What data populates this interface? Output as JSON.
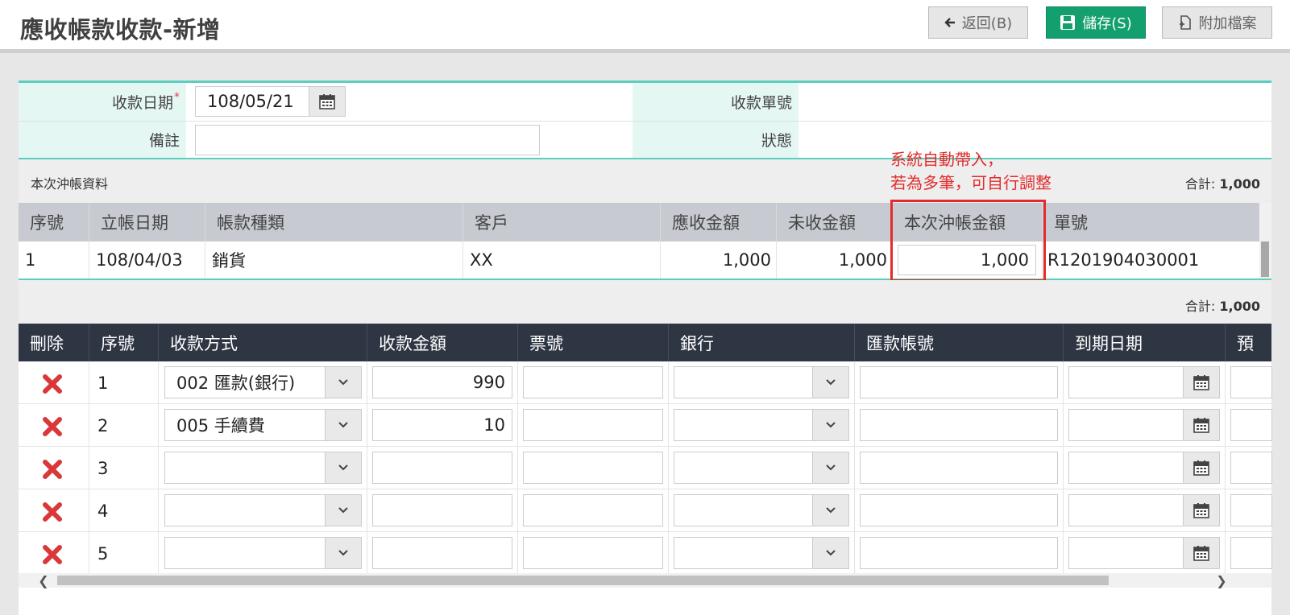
{
  "header": {
    "title": "應收帳款收款-新增",
    "back_label": "返回(B)",
    "save_label": "儲存(S)",
    "attach_label": "附加檔案"
  },
  "form": {
    "date_label": "收款日期",
    "date_required_mark": "*",
    "date_value": "108/05/21",
    "receipt_no_label": "收款單號",
    "receipt_no_value": "",
    "note_label": "備註",
    "note_value": "",
    "status_label": "狀態",
    "status_value": ""
  },
  "offset_section": {
    "title": "本次沖帳資料",
    "total_label": "合計:",
    "total_value": "1,000",
    "columns": [
      "序號",
      "立帳日期",
      "帳款種類",
      "客戶",
      "應收金額",
      "未收金額",
      "本次沖帳金額",
      "單號"
    ],
    "rows": [
      {
        "seq": "1",
        "date": "108/04/03",
        "type": "銷貨",
        "customer": "XX",
        "receivable": "1,000",
        "unreceived": "1,000",
        "offset": "1,000",
        "doc_no": "R1201904030001"
      }
    ]
  },
  "annotation": {
    "line1": "系統自動帶入，",
    "line2": "若為多筆，可自行調整",
    "color": "#e22c2c"
  },
  "payment_section": {
    "total_label": "合計:",
    "total_value": "1,000",
    "columns": [
      "刪除",
      "序號",
      "收款方式",
      "收款金額",
      "票號",
      "銀行",
      "匯款帳號",
      "到期日期",
      "預"
    ],
    "rows": [
      {
        "seq": "1",
        "method": "002 匯款(銀行)",
        "amount": "990"
      },
      {
        "seq": "2",
        "method": "005 手續費",
        "amount": "10"
      },
      {
        "seq": "3",
        "method": "",
        "amount": ""
      },
      {
        "seq": "4",
        "method": "",
        "amount": ""
      },
      {
        "seq": "5",
        "method": "",
        "amount": ""
      }
    ]
  },
  "colors": {
    "accent_teal": "#5bcfbf",
    "save_green": "#139f6e",
    "delete_red": "#d9383a",
    "dark_header": "#2e3543"
  }
}
